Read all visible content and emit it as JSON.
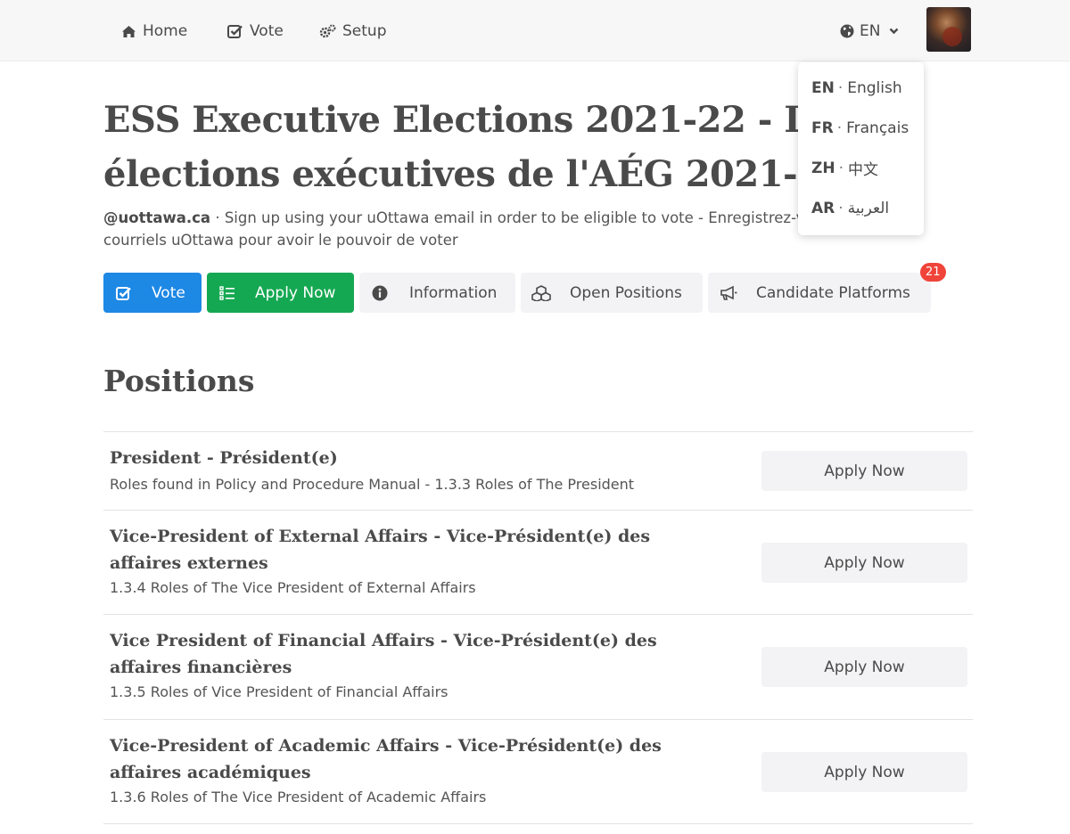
{
  "nav": {
    "home": "Home",
    "vote": "Vote",
    "setup": "Setup",
    "language": "EN"
  },
  "language_menu": [
    {
      "code": "EN",
      "label": "English"
    },
    {
      "code": "FR",
      "label": "Français"
    },
    {
      "code": "ZH",
      "label": "中文"
    },
    {
      "code": "AR",
      "label": "العربية"
    }
  ],
  "header": {
    "title": "ESS Executive Elections 2021-22 - Les élections exécutives de l'AÉG 2021-22",
    "domain": "@uottawa.ca",
    "description": "Sign up using your uOttawa email in order to be eligible to vote - Enregistrez-vous avec vos courriels uOttawa pour avoir le pouvoir de voter"
  },
  "actions": {
    "vote": "Vote",
    "apply": "Apply Now",
    "information": "Information",
    "open_positions": "Open Positions",
    "candidate_platforms": "Candidate Platforms",
    "candidate_count": "21"
  },
  "positions": {
    "heading": "Positions",
    "items": [
      {
        "title": "President - Président(e)",
        "description": "Roles found in Policy and Procedure Manual - 1.3.3 Roles of The President",
        "action": "Apply Now"
      },
      {
        "title": "Vice-President of External Affairs - Vice-Président(e) des affaires externes",
        "description": "1.3.4 Roles of The Vice President of External Affairs",
        "action": "Apply Now"
      },
      {
        "title": "Vice President of Financial Affairs - Vice-Président(e) des affaires financières",
        "description": "1.3.5 Roles of Vice President of Financial Affairs",
        "action": "Apply Now"
      },
      {
        "title": "Vice-President of Academic Affairs - Vice-Président(e) des affaires académiques",
        "description": "1.3.6 Roles of The Vice President of Academic Affairs",
        "action": "Apply Now"
      }
    ]
  },
  "colors": {
    "vote_button": "#1e88e5",
    "apply_button": "#15a852",
    "badge": "#f0443a"
  }
}
